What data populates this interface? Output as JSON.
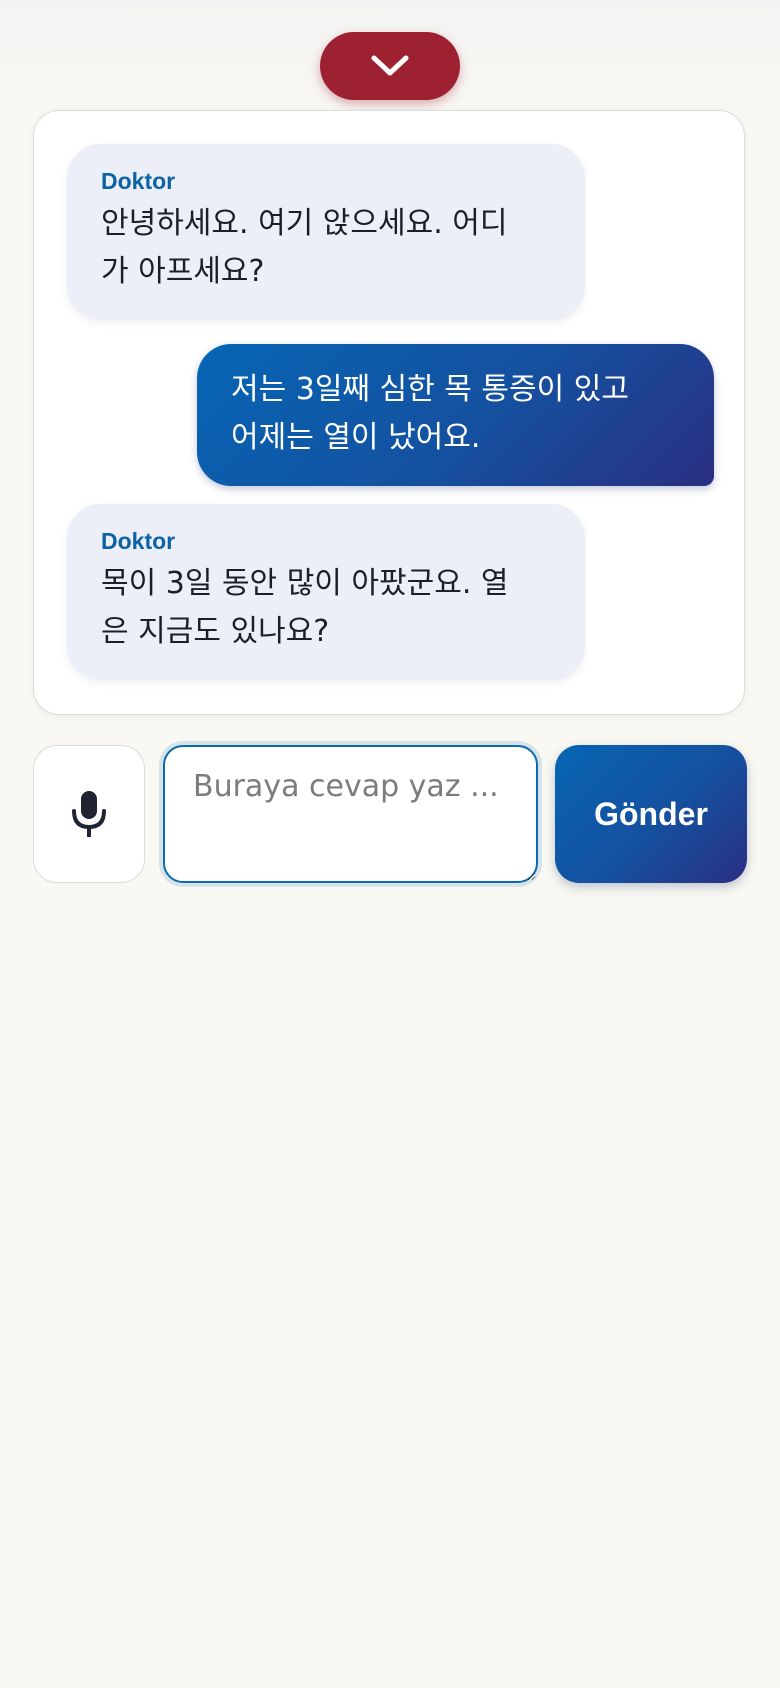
{
  "header": {
    "collapse_icon": "chevron-down-icon",
    "accent_color": "#9d2131"
  },
  "chat": {
    "messages": [
      {
        "role": "doctor",
        "sender": "Doktor",
        "line1": "안녕하세요. 여기 앉으세요. 어디",
        "line2": "가 아프세요?"
      },
      {
        "role": "user",
        "line1": "저는 3일째 심한 목 통증이 있고",
        "line2": "어제는 열이 났어요."
      },
      {
        "role": "doctor",
        "sender": "Doktor",
        "line1": "목이 3일 동안 많이 아팠군요. 열",
        "line2": "은 지금도 있나요?"
      }
    ]
  },
  "composer": {
    "mic_icon": "microphone-icon",
    "placeholder": "Buraya cevap yaz ...",
    "value": "",
    "send_label": "Gönder",
    "brand_color": "#15509f"
  }
}
